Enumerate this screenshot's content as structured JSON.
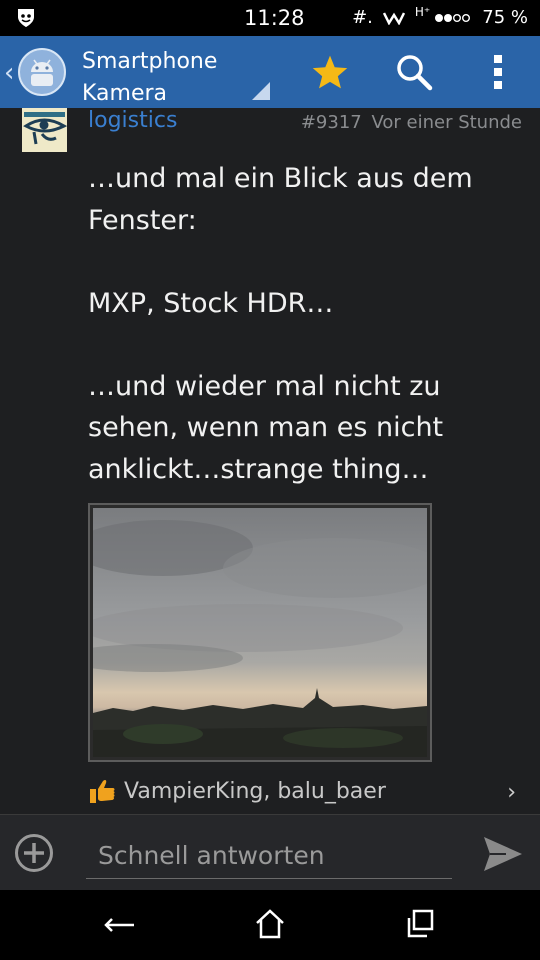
{
  "status_bar": {
    "time": "11:28",
    "signal_text": "#.",
    "network_text": "H⁺",
    "battery": "75 %"
  },
  "action_bar": {
    "title_line1": "Smartphone",
    "title_line2": "Kamera",
    "icons": [
      "back-chevron-icon",
      "android-app-icon",
      "star-icon",
      "search-icon",
      "overflow-menu-icon"
    ],
    "accent_color": "#2a64a8",
    "star_color": "#f5b916"
  },
  "post": {
    "author": "logistics",
    "post_number": "#9317",
    "time_ago": "Vor einer Stunde",
    "paragraphs": [
      "…und mal ein Blick aus dem Fenster:",
      "MXP, Stock HDR…",
      "…und wieder mal nicht zu sehen, wenn man es nicht anklickt…strange thing…"
    ],
    "likes": "VampierKing, balu_baer"
  },
  "reply": {
    "placeholder": "Schnell antworten"
  },
  "nav": {
    "icons": [
      "back-icon",
      "home-icon",
      "recents-icon"
    ]
  }
}
